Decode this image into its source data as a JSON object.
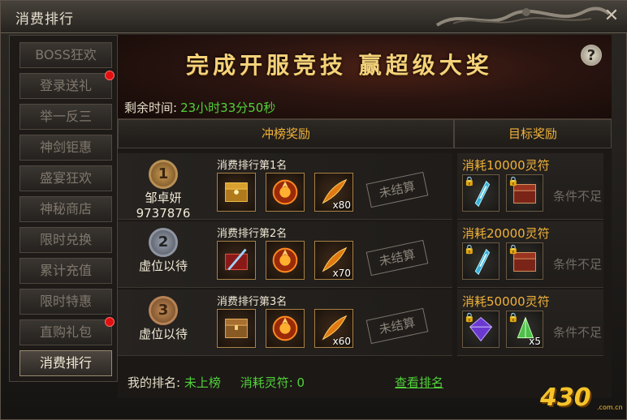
{
  "window": {
    "title": "消费排行",
    "close_glyph": "✕"
  },
  "sidebar": {
    "items": [
      {
        "label": "BOSS狂欢",
        "active": false,
        "dot": false
      },
      {
        "label": "登录送礼",
        "active": false,
        "dot": true
      },
      {
        "label": "举一反三",
        "active": false,
        "dot": false
      },
      {
        "label": "神剑钜惠",
        "active": false,
        "dot": false
      },
      {
        "label": "盛宴狂欢",
        "active": false,
        "dot": false
      },
      {
        "label": "神秘商店",
        "active": false,
        "dot": false
      },
      {
        "label": "限时兑换",
        "active": false,
        "dot": false
      },
      {
        "label": "累计充值",
        "active": false,
        "dot": false
      },
      {
        "label": "限时特惠",
        "active": false,
        "dot": false
      },
      {
        "label": "直购礼包",
        "active": false,
        "dot": true
      },
      {
        "label": "消费排行",
        "active": true,
        "dot": false
      }
    ]
  },
  "banner": {
    "text": "完成开服竞技  赢超级大奖",
    "help": "?"
  },
  "timer": {
    "label": "剩余时间:",
    "value": "23小时33分50秒"
  },
  "sections": {
    "rank": "冲榜奖励",
    "target": "目标奖励"
  },
  "ranks": [
    {
      "medal": "1",
      "name_line1": "邹卓妍",
      "name_line2": "9737876",
      "place": "消费排行第1名",
      "items": [
        {
          "icon": "gold-chest-icon",
          "count": ""
        },
        {
          "icon": "flame-orb-icon",
          "count": ""
        },
        {
          "icon": "fire-feather-icon",
          "count": "x80"
        }
      ],
      "status": "未结算"
    },
    {
      "medal": "2",
      "name_line1": "虚位以待",
      "name_line2": "",
      "place": "消费排行第2名",
      "items": [
        {
          "icon": "red-sword-chest-icon",
          "count": ""
        },
        {
          "icon": "flame-orb-icon",
          "count": ""
        },
        {
          "icon": "fire-feather-icon",
          "count": "x70"
        }
      ],
      "status": "未结算"
    },
    {
      "medal": "3",
      "name_line1": "虚位以待",
      "name_line2": "",
      "place": "消费排行第3名",
      "items": [
        {
          "icon": "wood-chest-icon",
          "count": ""
        },
        {
          "icon": "flame-orb-icon",
          "count": ""
        },
        {
          "icon": "fire-feather-icon",
          "count": "x60"
        }
      ],
      "status": "未结算"
    }
  ],
  "targets": [
    {
      "title": "消耗10000灵符",
      "items": [
        {
          "icon": "blue-crystal-icon",
          "count": ""
        },
        {
          "icon": "red-chest-icon",
          "count": ""
        }
      ],
      "status": "条件不足"
    },
    {
      "title": "消耗20000灵符",
      "items": [
        {
          "icon": "blue-crystal-icon",
          "count": ""
        },
        {
          "icon": "red-chest-icon",
          "count": ""
        }
      ],
      "status": "条件不足"
    },
    {
      "title": "消耗50000灵符",
      "items": [
        {
          "icon": "purple-gem-icon",
          "count": ""
        },
        {
          "icon": "green-crystal-icon",
          "count": "x5"
        }
      ],
      "status": "条件不足"
    }
  ],
  "footer": {
    "my_rank_label": "我的排名:",
    "my_rank_value": "未上榜",
    "spent_label": "消耗灵符:",
    "spent_value": "0",
    "view_link": "查看排名"
  },
  "logo": {
    "text": "430",
    "sub": ".com.cn"
  },
  "colors": {
    "gold": "#f0b23a",
    "green": "#52d13a",
    "red_dot": "#e01010"
  }
}
